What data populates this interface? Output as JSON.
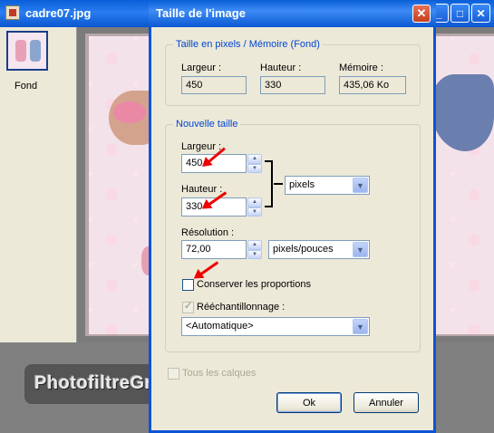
{
  "background_window": {
    "title": "cadre07.jpg",
    "controls": {
      "minimize": "_",
      "maximize": "□",
      "close": "✕"
    },
    "layer_label": "Fond"
  },
  "watermark": "PhotofiltreGraphic",
  "dialog": {
    "title": "Taille de l'image",
    "close_glyph": "✕",
    "current": {
      "legend": "Taille en pixels / Mémoire (Fond)",
      "width_label": "Largeur :",
      "width_value": "450",
      "height_label": "Hauteur :",
      "height_value": "330",
      "memory_label": "Mémoire :",
      "memory_value": "435,06 Ko"
    },
    "new_size": {
      "legend": "Nouvelle taille",
      "width_label": "Largeur :",
      "width_value": "450",
      "height_label": "Hauteur :",
      "height_value": "330",
      "unit_value": "pixels",
      "resolution_label": "Résolution :",
      "resolution_value": "72,00",
      "resolution_unit_value": "pixels/pouces",
      "keep_ratio_label": "Conserver les proportions",
      "keep_ratio_checked": false,
      "resample_label": "Rééchantillonnage :",
      "resample_checked": true,
      "resample_value": "<Automatique>"
    },
    "all_layers_label": "Tous les calques",
    "ok_label": "Ok",
    "cancel_label": "Annuler"
  },
  "colors": {
    "title_blue": "#0a5fd8",
    "dialog_bg": "#ece9d8",
    "group_legend": "#0046d5",
    "annotation_arrow": "#e00000"
  },
  "icons": [
    "image-file-icon",
    "spin-up-icon",
    "spin-down-icon",
    "dropdown-arrow-icon",
    "close-icon",
    "red-arrow-annotation"
  ]
}
